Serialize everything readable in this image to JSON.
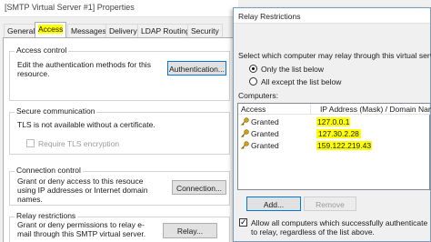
{
  "props": {
    "title": "[SMTP Virtual Server #1] Properties",
    "tabs": [
      "General",
      "Access",
      "Messages",
      "Delivery",
      "LDAP Routing",
      "Security"
    ],
    "access_control": {
      "label": "Access control",
      "text": "Edit the authentication methods for this resource.",
      "button": "Authentication..."
    },
    "secure_comm": {
      "label": "Secure communication",
      "text": "TLS is not available without a certificate.",
      "checkbox": "Require TLS encryption"
    },
    "connection_control": {
      "label": "Connection control",
      "text": "Grant or deny access to this resouce using IP addresses or Internet domain names.",
      "button": "Connection..."
    },
    "relay_restrictions": {
      "label": "Relay restrictions",
      "text": "Grant or deny permissions to relay e-mail through this SMTP virtual server.",
      "button": "Relay..."
    }
  },
  "relay": {
    "title": "Relay Restrictions",
    "prompt": "Select which computer may relay through this virtual server:",
    "options": [
      "Only the list below",
      "All except the list below"
    ],
    "selected_option": 0,
    "computers_label": "Computers:",
    "columns": [
      "Access",
      "IP Address (Mask) / Domain Name"
    ],
    "rows": [
      {
        "access": "Granted",
        "address": "127.0.0.1"
      },
      {
        "access": "Granted",
        "address": "127.30.2.28"
      },
      {
        "access": "Granted",
        "address": "159.122.219.43"
      }
    ],
    "add_button": "Add...",
    "remove_button": "Remove",
    "allow_checkbox": "Allow all computers which successfully authenticate to relay, regardless of the list above.",
    "allow_checked": true
  },
  "colors": {
    "highlight": "#ffff00",
    "key_icon": "#d4a017"
  },
  "icons": {
    "row_icon": "key-icon"
  }
}
